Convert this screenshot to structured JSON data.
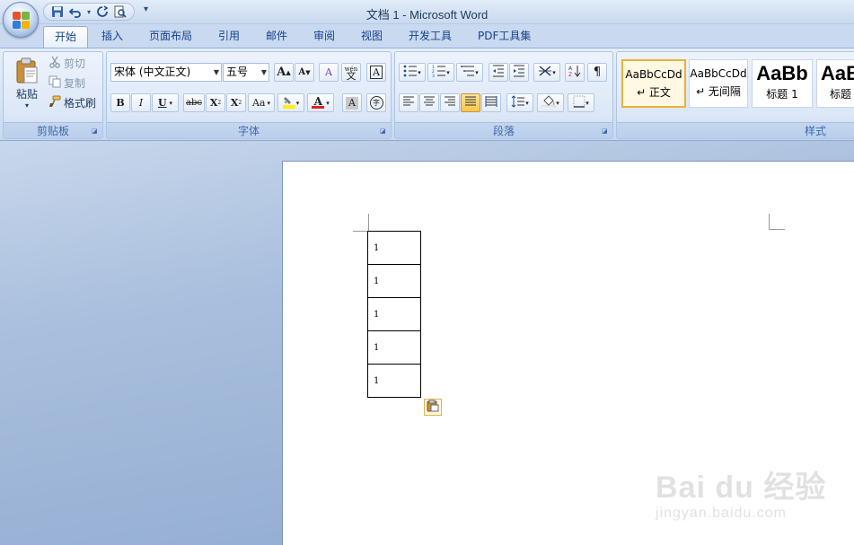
{
  "window": {
    "title": "文档 1 - Microsoft Word"
  },
  "quick_access": {
    "more": "▾"
  },
  "tabs": [
    {
      "label": "开始"
    },
    {
      "label": "插入"
    },
    {
      "label": "页面布局"
    },
    {
      "label": "引用"
    },
    {
      "label": "邮件"
    },
    {
      "label": "审阅"
    },
    {
      "label": "视图"
    },
    {
      "label": "开发工具"
    },
    {
      "label": "PDF工具集"
    }
  ],
  "clipboard": {
    "group_label": "剪贴板",
    "paste_label": "粘贴",
    "paste_arrow": "▾",
    "cut_label": "剪切",
    "copy_label": "复制",
    "format_painter_label": "格式刷"
  },
  "font": {
    "group_label": "字体",
    "font_name": "宋体 (中文正文)",
    "font_size": "五号",
    "grow": "A",
    "shrink": "A",
    "clear": "A",
    "phonetic": "wén",
    "phonetic_char": "文",
    "border_char": "A",
    "bold": "B",
    "italic": "I",
    "underline": "U",
    "strike": "abc",
    "subscript": "X",
    "superscript": "X",
    "case": "Aa",
    "highlight_color": "#fff200",
    "font_color": "#e02020",
    "shade_char": "A",
    "enclose_char": "字"
  },
  "paragraph": {
    "group_label": "段落"
  },
  "styles": {
    "group_label": "样式",
    "items": [
      {
        "sample": "AaBbCcDd",
        "name": "↵ 正文"
      },
      {
        "sample": "AaBbCcDd",
        "name": "↵ 无间隔"
      },
      {
        "sample": "AaBb",
        "name": "标题 1"
      },
      {
        "sample": "AaB",
        "name": "标题"
      }
    ]
  },
  "document": {
    "table": [
      "1",
      "1",
      "1",
      "1",
      "1"
    ]
  },
  "watermark": {
    "main": "Bai du 经验",
    "sub": "jingyan.baidu.com"
  },
  "colors": {
    "accent": "#15428b",
    "ribbon": "#d7e4f5",
    "selected_style": "#e8b23a"
  }
}
